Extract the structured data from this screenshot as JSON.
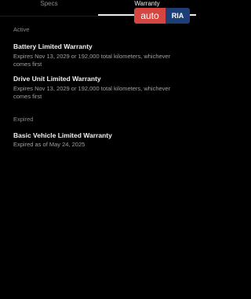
{
  "tabs": [
    {
      "label": "Specs",
      "active": false
    },
    {
      "label": "Warranty",
      "active": true
    }
  ],
  "watermark": {
    "left": "auto",
    "right": "RIA"
  },
  "sections": {
    "active": {
      "label": "Active",
      "items": [
        {
          "title": "Battery Limited Warranty",
          "description": "Expires Nov 13, 2029 or 192,000 total kilometers, whichever comes first"
        },
        {
          "title": "Drive Unit Limited Warranty",
          "description": "Expires Nov 13, 2029 or 192,000 total kilometers, whichever comes first"
        }
      ]
    },
    "expired": {
      "label": "Expired",
      "items": [
        {
          "title": "Basic Vehicle Limited Warranty",
          "description": "Expired as of May 24, 2025"
        }
      ]
    }
  },
  "colors": {
    "background": "#000000",
    "title_text": "#f0f0f0",
    "secondary_text": "#a0a0a0",
    "watermark_red": "#d4463f",
    "watermark_blue": "#1d3f78"
  }
}
